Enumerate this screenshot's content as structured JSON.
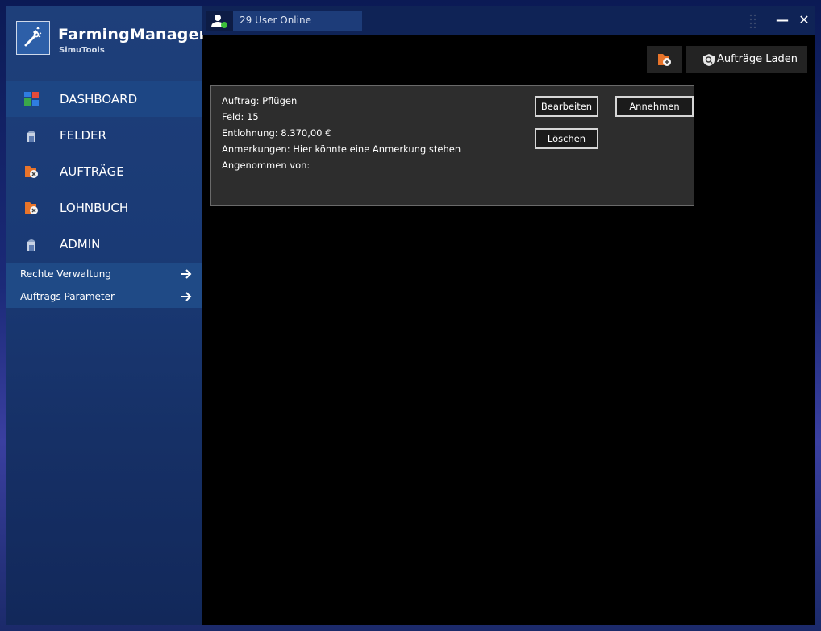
{
  "app": {
    "title": "FarmingManager",
    "subtitle": "SimuTools"
  },
  "topbar": {
    "online_text": "29 User Online",
    "minimize_label": "—",
    "close_label": "✕"
  },
  "sidebar": {
    "items": [
      {
        "label": "DASHBOARD",
        "icon": "dashboard-icon"
      },
      {
        "label": "FELDER",
        "icon": "silo-icon"
      },
      {
        "label": "AUFTRÄGE",
        "icon": "folder-cancel-icon"
      },
      {
        "label": "LOHNBUCH",
        "icon": "folder-cancel-icon"
      },
      {
        "label": "ADMIN",
        "icon": "silo-icon"
      }
    ],
    "subitems": [
      {
        "label": "Rechte Verwaltung",
        "icon": "arrow-right-icon"
      },
      {
        "label": "Auftrags Parameter",
        "icon": "arrow-right-icon"
      }
    ]
  },
  "toolbar": {
    "add_icon": "folder-add-icon",
    "load_label": "Aufträge Laden",
    "load_icon": "search-shield-icon"
  },
  "order": {
    "auftrag": "Auftrag: Pflügen",
    "feld": "Feld: 15",
    "entlohnung": "Entlohnung: 8.370,00 €",
    "anmerkungen": "Anmerkungen: Hier könnte eine Anmerkung stehen",
    "angenommen": "Angenommen von:",
    "edit_label": "Bearbeiten",
    "accept_label": "Annehmen",
    "delete_label": "Löschen"
  },
  "colors": {
    "sidebar": "#1e3f7a",
    "topbar": "#0f2356",
    "card": "#2d2d2d",
    "accent_orange": "#e8742a",
    "status_green": "#3cc13b"
  }
}
